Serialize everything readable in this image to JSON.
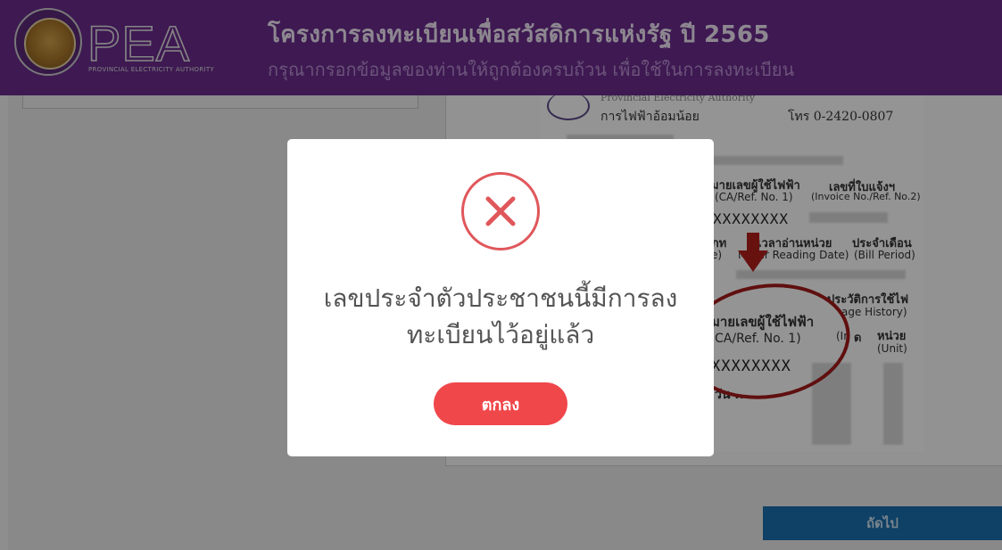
{
  "header": {
    "logo_text": "PEA",
    "logo_subtext": "PROVINCIAL ELECTRICITY AUTHORITY",
    "title": "โครงการลงทะเบียนเพื่อสวัสดิการแห่งรัฐ ปี 2565",
    "subtitle": "กรุณากรอกข้อมูลของท่านให้ถูกต้องครบถ้วน เพื่อใช้ในการลงทะเบียน",
    "color": "#6b2c8e"
  },
  "bill_sample": {
    "authority_en": "Provincial Electricity Authority",
    "office_th": "การไฟฟ้าอ้อมน้อย",
    "phone": "โทร 0-2420-0807",
    "col_ca_label": "มายเลขผู้ใช้ไฟฟ้า",
    "col_ca_sub": "(CA/Ref. No. 1)",
    "col_invoice_label": "เลขที่ใบแจ้งฯ",
    "col_invoice_sub": "(Invoice No./Ref. No.2)",
    "ca_value_top": "XXXXXXXX",
    "type_label": "ภท",
    "type_sub": "e)",
    "meter_label": "เวลาอ่านหน่วย",
    "meter_sub": "Meter Reading Date)",
    "period_label": "ประจำเดือน",
    "period_sub": "(Bill Period)",
    "history_label": "ประวัติการใช้ไฟ",
    "history_sub": "age History)",
    "ca_label_2": "มายเลขผู้ใช้ไฟฟ้า",
    "ca_sub_2": "CA/Ref. No. 1)",
    "index_label": "(In",
    "index_sub": "ด",
    "unit_label": "หน่วย",
    "unit_sub": "(Unit)",
    "ca_value_bottom": "XXXXXXXX",
    "date_partial": "วัน ..."
  },
  "next_button": {
    "label": "ถัดไป",
    "color": "#1b6fae"
  },
  "modal": {
    "icon": "error-x-icon",
    "message_line1": "เลขประจำตัวประชาชนนี้มีการลง",
    "message_line2": "ทะเบียนไว้อยู่แล้ว",
    "ok_label": "ตกลง",
    "accent": "#f0474b"
  }
}
